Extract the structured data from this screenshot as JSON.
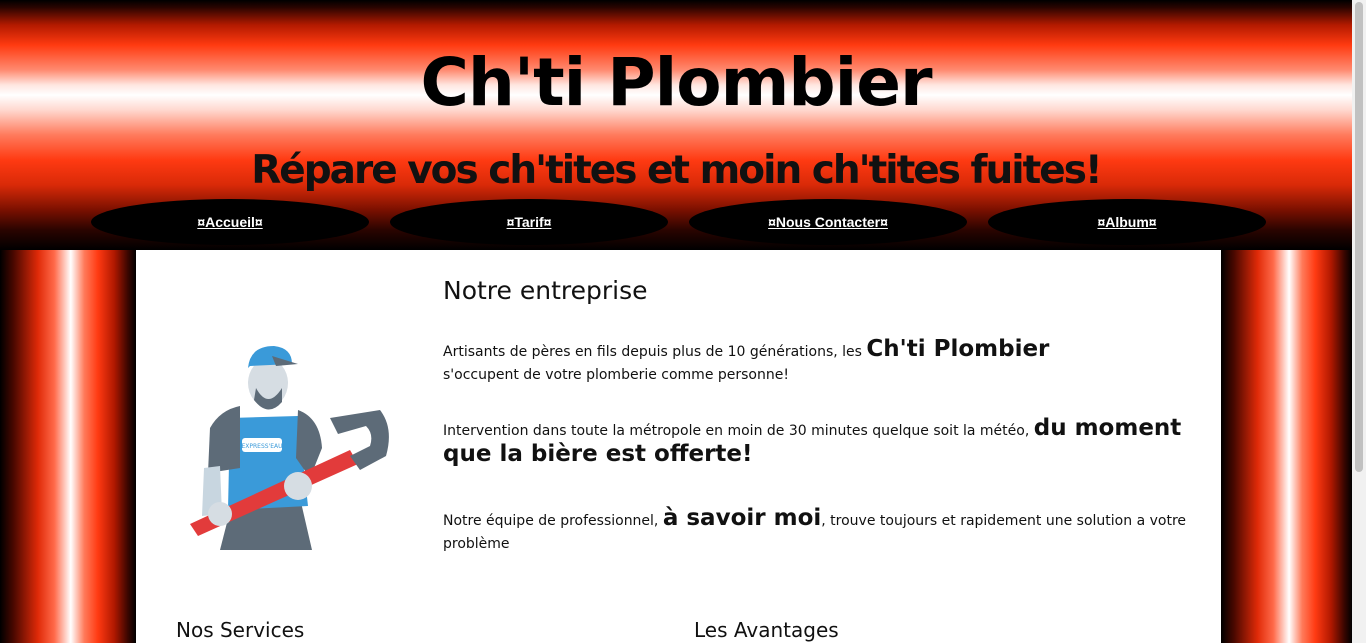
{
  "header": {
    "title": "Ch'ti Plombier",
    "tagline": "Répare vos ch'tites et moin ch'tites fuites!"
  },
  "nav": {
    "items": [
      {
        "label": "¤Accueil¤"
      },
      {
        "label": "¤Tarif¤"
      },
      {
        "label": "¤Nous Contacter¤"
      },
      {
        "label": "¤Album¤"
      }
    ]
  },
  "main": {
    "section_title": "Notre entreprise",
    "p1": {
      "before": "Artisants de pères en fils depuis plus de 10 générations, les ",
      "emphasis": "Ch'ti Plombier",
      "after": " s'occupent de votre plomberie comme personne!"
    },
    "p2": {
      "before": "Intervention dans toute la métropole en moin de 30 minutes quelque soit la météo, ",
      "emphasis": "du moment que la bière est offerte!",
      "after": ""
    },
    "p3": {
      "before": "Notre équipe de professionnel, ",
      "emphasis": "à savoir moi",
      "after": ", trouve toujours et rapidement une solution a votre problème"
    },
    "services_title": "Nos Services",
    "advantages_title": "Les Avantages",
    "image_logo_text": "EXPRESS'EAU"
  },
  "colors": {
    "accent_red": "#ff3a12",
    "nav_bg": "#000000",
    "nav_text": "#ffffff",
    "content_bg": "#ffffff"
  }
}
